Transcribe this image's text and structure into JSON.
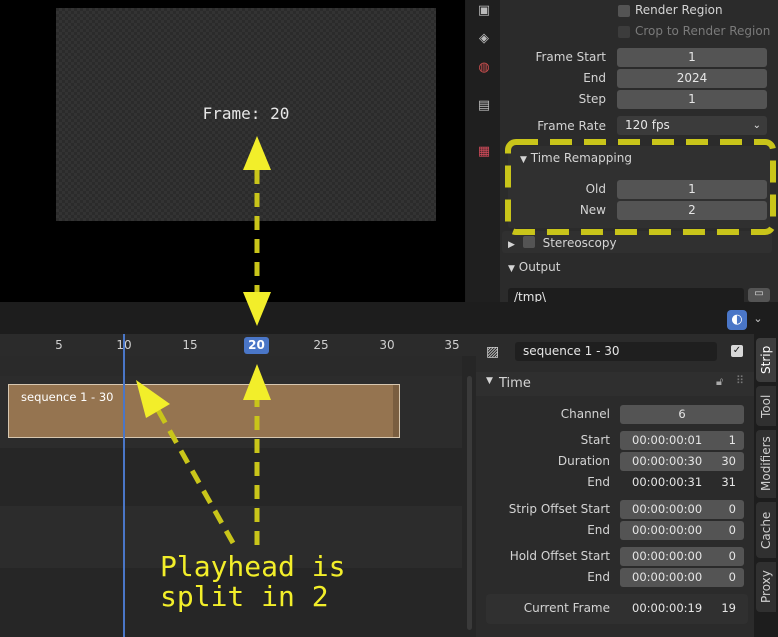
{
  "preview": {
    "frame_text": "Frame: 20"
  },
  "props": {
    "render_region": "Render Region",
    "crop_to_render_region": "Crop to Render Region",
    "frame_start_label": "Frame Start",
    "frame_start": "1",
    "end_label": "End",
    "end": "2024",
    "step_label": "Step",
    "step": "1",
    "frame_rate_label": "Frame Rate",
    "frame_rate": "120 fps",
    "time_remapping": "Time Remapping",
    "old_label": "Old",
    "old": "1",
    "new_label": "New",
    "new": "2",
    "stereoscopy": "Stereoscopy",
    "output": "Output",
    "output_path": "/tmp\\"
  },
  "timeline": {
    "ticks": [
      "5",
      "10",
      "15",
      "20",
      "25",
      "30",
      "35"
    ],
    "current_frame": "20",
    "strip_label": "sequence 1 - 30"
  },
  "sidebar": {
    "strip_name": "sequence 1 - 30",
    "time_header": "Time",
    "channel_label": "Channel",
    "channel": "6",
    "start_label": "Start",
    "start_tc": "00:00:00:01",
    "start_n": "1",
    "duration_label": "Duration",
    "duration_tc": "00:00:00:30",
    "duration_n": "30",
    "end_label": "End",
    "end_tc": "00:00:00:31",
    "end_n": "31",
    "strip_offset_start_label": "Strip Offset Start",
    "strip_offset_start_tc": "00:00:00:00",
    "strip_offset_start_n": "0",
    "strip_offset_end_label": "End",
    "strip_offset_end_tc": "00:00:00:00",
    "strip_offset_end_n": "0",
    "hold_offset_start_label": "Hold Offset Start",
    "hold_offset_start_tc": "00:00:00:00",
    "hold_offset_start_n": "0",
    "hold_offset_end_label": "End",
    "hold_offset_end_tc": "00:00:00:00",
    "hold_offset_end_n": "0",
    "current_frame_label": "Current Frame",
    "current_frame_tc": "00:00:00:19",
    "current_frame_n": "19"
  },
  "side_tabs": [
    "Strip",
    "Tool",
    "Modifiers",
    "Cache",
    "Proxy"
  ],
  "annotation": {
    "caption": "Playhead is\nsplit in 2"
  },
  "colors": {
    "annotation_yellow": "#e6e21d",
    "playhead_blue": "#4a76c7",
    "strip_brown": "#957450"
  }
}
